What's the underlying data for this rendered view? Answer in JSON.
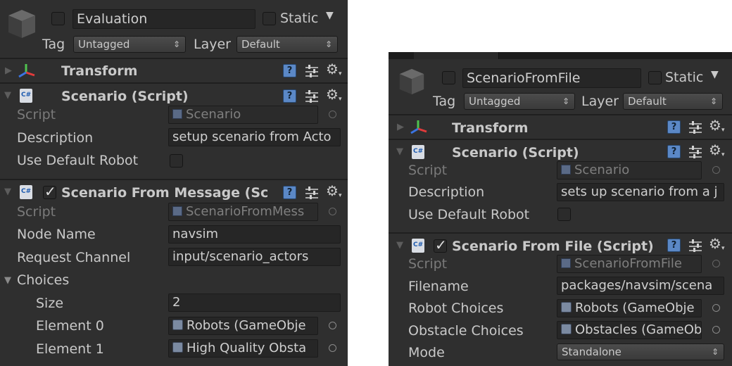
{
  "left": {
    "header": {
      "name": "Evaluation",
      "static_label": "Static",
      "tag_label": "Tag",
      "tag_value": "Untagged",
      "layer_label": "Layer",
      "layer_value": "Default"
    },
    "transform": {
      "title": "Transform"
    },
    "scenario": {
      "title": "Scenario (Script)",
      "script_label": "Script",
      "script_value": "Scenario",
      "description_label": "Description",
      "description_value": "setup scenario from Acto",
      "use_default_robot_label": "Use Default Robot",
      "use_default_robot": false
    },
    "message": {
      "title": "Scenario From Message (Sc",
      "enabled": true,
      "script_label": "Script",
      "script_value": "ScenarioFromMess",
      "node_name_label": "Node Name",
      "node_name_value": "navsim",
      "request_channel_label": "Request Channel",
      "request_channel_value": "input/scenario_actors",
      "choices_label": "Choices",
      "size_label": "Size",
      "size_value": "2",
      "element0_label": "Element 0",
      "element0_value": "Robots (GameObje",
      "element1_label": "Element 1",
      "element1_value": "High Quality Obsta"
    }
  },
  "right": {
    "header": {
      "name": "ScenarioFromFile",
      "static_label": "Static",
      "tag_label": "Tag",
      "tag_value": "Untagged",
      "layer_label": "Layer",
      "layer_value": "Default"
    },
    "transform": {
      "title": "Transform"
    },
    "scenario": {
      "title": "Scenario (Script)",
      "script_label": "Script",
      "script_value": "Scenario",
      "description_label": "Description",
      "description_value": "sets up scenario from a j",
      "use_default_robot_label": "Use Default Robot",
      "use_default_robot": false
    },
    "file": {
      "title": "Scenario From File (Script)",
      "enabled": true,
      "script_label": "Script",
      "script_value": "ScenarioFromFile",
      "filename_label": "Filename",
      "filename_value": "packages/navsim/scena",
      "robot_choices_label": "Robot Choices",
      "robot_choices_value": "Robots (GameObje",
      "obstacle_choices_label": "Obstacle Choices",
      "obstacle_choices_value": "Obstacles (GameOb",
      "mode_label": "Mode",
      "mode_value": "Standalone"
    }
  },
  "icons": {
    "help": "?",
    "gear": "gear-icon",
    "presets": "sliders-icon",
    "object_picker": "circle-icon",
    "transform": "axis-icon",
    "script": "csharp-icon",
    "gameobject": "cube-icon"
  }
}
